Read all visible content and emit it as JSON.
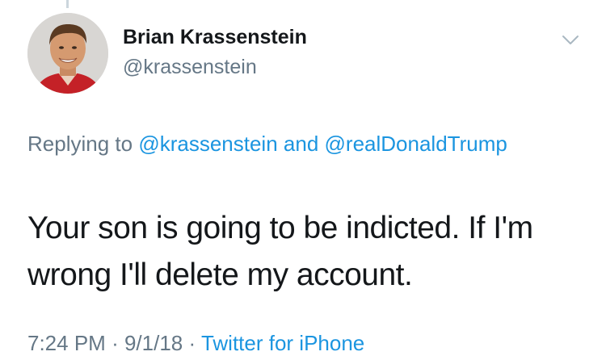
{
  "author": {
    "name": "Brian Krassenstein",
    "handle": "@krassenstein",
    "avatar_icon": "profile-photo"
  },
  "reply_context": {
    "prefix": "Replying to",
    "mention_1": "@krassenstein",
    "conjunction": "and",
    "mention_2": "@realDonaldTrump"
  },
  "tweet": {
    "text": "Your son is going to be indicted. If I'm wrong I'll delete my account."
  },
  "meta": {
    "time": "7:24 PM",
    "separator": "·",
    "date": "9/1/18",
    "source": "Twitter for iPhone"
  },
  "colors": {
    "link": "#1b95e0",
    "secondary_text": "#657786",
    "primary_text": "#14171a"
  },
  "icons": {
    "menu": "chevron-down-icon"
  }
}
